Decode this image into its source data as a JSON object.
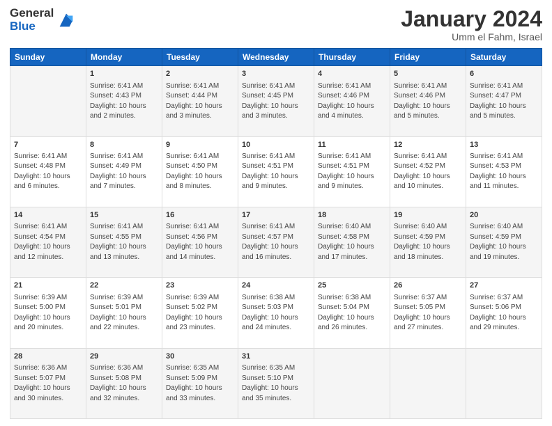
{
  "header": {
    "logo_general": "General",
    "logo_blue": "Blue",
    "title": "January 2024",
    "subtitle": "Umm el Fahm, Israel"
  },
  "calendar": {
    "weekdays": [
      "Sunday",
      "Monday",
      "Tuesday",
      "Wednesday",
      "Thursday",
      "Friday",
      "Saturday"
    ],
    "weeks": [
      [
        {
          "day": "",
          "sunrise": "",
          "sunset": "",
          "daylight": ""
        },
        {
          "day": "1",
          "sunrise": "Sunrise: 6:41 AM",
          "sunset": "Sunset: 4:43 PM",
          "daylight": "Daylight: 10 hours and 2 minutes."
        },
        {
          "day": "2",
          "sunrise": "Sunrise: 6:41 AM",
          "sunset": "Sunset: 4:44 PM",
          "daylight": "Daylight: 10 hours and 3 minutes."
        },
        {
          "day": "3",
          "sunrise": "Sunrise: 6:41 AM",
          "sunset": "Sunset: 4:45 PM",
          "daylight": "Daylight: 10 hours and 3 minutes."
        },
        {
          "day": "4",
          "sunrise": "Sunrise: 6:41 AM",
          "sunset": "Sunset: 4:46 PM",
          "daylight": "Daylight: 10 hours and 4 minutes."
        },
        {
          "day": "5",
          "sunrise": "Sunrise: 6:41 AM",
          "sunset": "Sunset: 4:46 PM",
          "daylight": "Daylight: 10 hours and 5 minutes."
        },
        {
          "day": "6",
          "sunrise": "Sunrise: 6:41 AM",
          "sunset": "Sunset: 4:47 PM",
          "daylight": "Daylight: 10 hours and 5 minutes."
        }
      ],
      [
        {
          "day": "7",
          "sunrise": "Sunrise: 6:41 AM",
          "sunset": "Sunset: 4:48 PM",
          "daylight": "Daylight: 10 hours and 6 minutes."
        },
        {
          "day": "8",
          "sunrise": "Sunrise: 6:41 AM",
          "sunset": "Sunset: 4:49 PM",
          "daylight": "Daylight: 10 hours and 7 minutes."
        },
        {
          "day": "9",
          "sunrise": "Sunrise: 6:41 AM",
          "sunset": "Sunset: 4:50 PM",
          "daylight": "Daylight: 10 hours and 8 minutes."
        },
        {
          "day": "10",
          "sunrise": "Sunrise: 6:41 AM",
          "sunset": "Sunset: 4:51 PM",
          "daylight": "Daylight: 10 hours and 9 minutes."
        },
        {
          "day": "11",
          "sunrise": "Sunrise: 6:41 AM",
          "sunset": "Sunset: 4:51 PM",
          "daylight": "Daylight: 10 hours and 9 minutes."
        },
        {
          "day": "12",
          "sunrise": "Sunrise: 6:41 AM",
          "sunset": "Sunset: 4:52 PM",
          "daylight": "Daylight: 10 hours and 10 minutes."
        },
        {
          "day": "13",
          "sunrise": "Sunrise: 6:41 AM",
          "sunset": "Sunset: 4:53 PM",
          "daylight": "Daylight: 10 hours and 11 minutes."
        }
      ],
      [
        {
          "day": "14",
          "sunrise": "Sunrise: 6:41 AM",
          "sunset": "Sunset: 4:54 PM",
          "daylight": "Daylight: 10 hours and 12 minutes."
        },
        {
          "day": "15",
          "sunrise": "Sunrise: 6:41 AM",
          "sunset": "Sunset: 4:55 PM",
          "daylight": "Daylight: 10 hours and 13 minutes."
        },
        {
          "day": "16",
          "sunrise": "Sunrise: 6:41 AM",
          "sunset": "Sunset: 4:56 PM",
          "daylight": "Daylight: 10 hours and 14 minutes."
        },
        {
          "day": "17",
          "sunrise": "Sunrise: 6:41 AM",
          "sunset": "Sunset: 4:57 PM",
          "daylight": "Daylight: 10 hours and 16 minutes."
        },
        {
          "day": "18",
          "sunrise": "Sunrise: 6:40 AM",
          "sunset": "Sunset: 4:58 PM",
          "daylight": "Daylight: 10 hours and 17 minutes."
        },
        {
          "day": "19",
          "sunrise": "Sunrise: 6:40 AM",
          "sunset": "Sunset: 4:59 PM",
          "daylight": "Daylight: 10 hours and 18 minutes."
        },
        {
          "day": "20",
          "sunrise": "Sunrise: 6:40 AM",
          "sunset": "Sunset: 4:59 PM",
          "daylight": "Daylight: 10 hours and 19 minutes."
        }
      ],
      [
        {
          "day": "21",
          "sunrise": "Sunrise: 6:39 AM",
          "sunset": "Sunset: 5:00 PM",
          "daylight": "Daylight: 10 hours and 20 minutes."
        },
        {
          "day": "22",
          "sunrise": "Sunrise: 6:39 AM",
          "sunset": "Sunset: 5:01 PM",
          "daylight": "Daylight: 10 hours and 22 minutes."
        },
        {
          "day": "23",
          "sunrise": "Sunrise: 6:39 AM",
          "sunset": "Sunset: 5:02 PM",
          "daylight": "Daylight: 10 hours and 23 minutes."
        },
        {
          "day": "24",
          "sunrise": "Sunrise: 6:38 AM",
          "sunset": "Sunset: 5:03 PM",
          "daylight": "Daylight: 10 hours and 24 minutes."
        },
        {
          "day": "25",
          "sunrise": "Sunrise: 6:38 AM",
          "sunset": "Sunset: 5:04 PM",
          "daylight": "Daylight: 10 hours and 26 minutes."
        },
        {
          "day": "26",
          "sunrise": "Sunrise: 6:37 AM",
          "sunset": "Sunset: 5:05 PM",
          "daylight": "Daylight: 10 hours and 27 minutes."
        },
        {
          "day": "27",
          "sunrise": "Sunrise: 6:37 AM",
          "sunset": "Sunset: 5:06 PM",
          "daylight": "Daylight: 10 hours and 29 minutes."
        }
      ],
      [
        {
          "day": "28",
          "sunrise": "Sunrise: 6:36 AM",
          "sunset": "Sunset: 5:07 PM",
          "daylight": "Daylight: 10 hours and 30 minutes."
        },
        {
          "day": "29",
          "sunrise": "Sunrise: 6:36 AM",
          "sunset": "Sunset: 5:08 PM",
          "daylight": "Daylight: 10 hours and 32 minutes."
        },
        {
          "day": "30",
          "sunrise": "Sunrise: 6:35 AM",
          "sunset": "Sunset: 5:09 PM",
          "daylight": "Daylight: 10 hours and 33 minutes."
        },
        {
          "day": "31",
          "sunrise": "Sunrise: 6:35 AM",
          "sunset": "Sunset: 5:10 PM",
          "daylight": "Daylight: 10 hours and 35 minutes."
        },
        {
          "day": "",
          "sunrise": "",
          "sunset": "",
          "daylight": ""
        },
        {
          "day": "",
          "sunrise": "",
          "sunset": "",
          "daylight": ""
        },
        {
          "day": "",
          "sunrise": "",
          "sunset": "",
          "daylight": ""
        }
      ]
    ]
  }
}
